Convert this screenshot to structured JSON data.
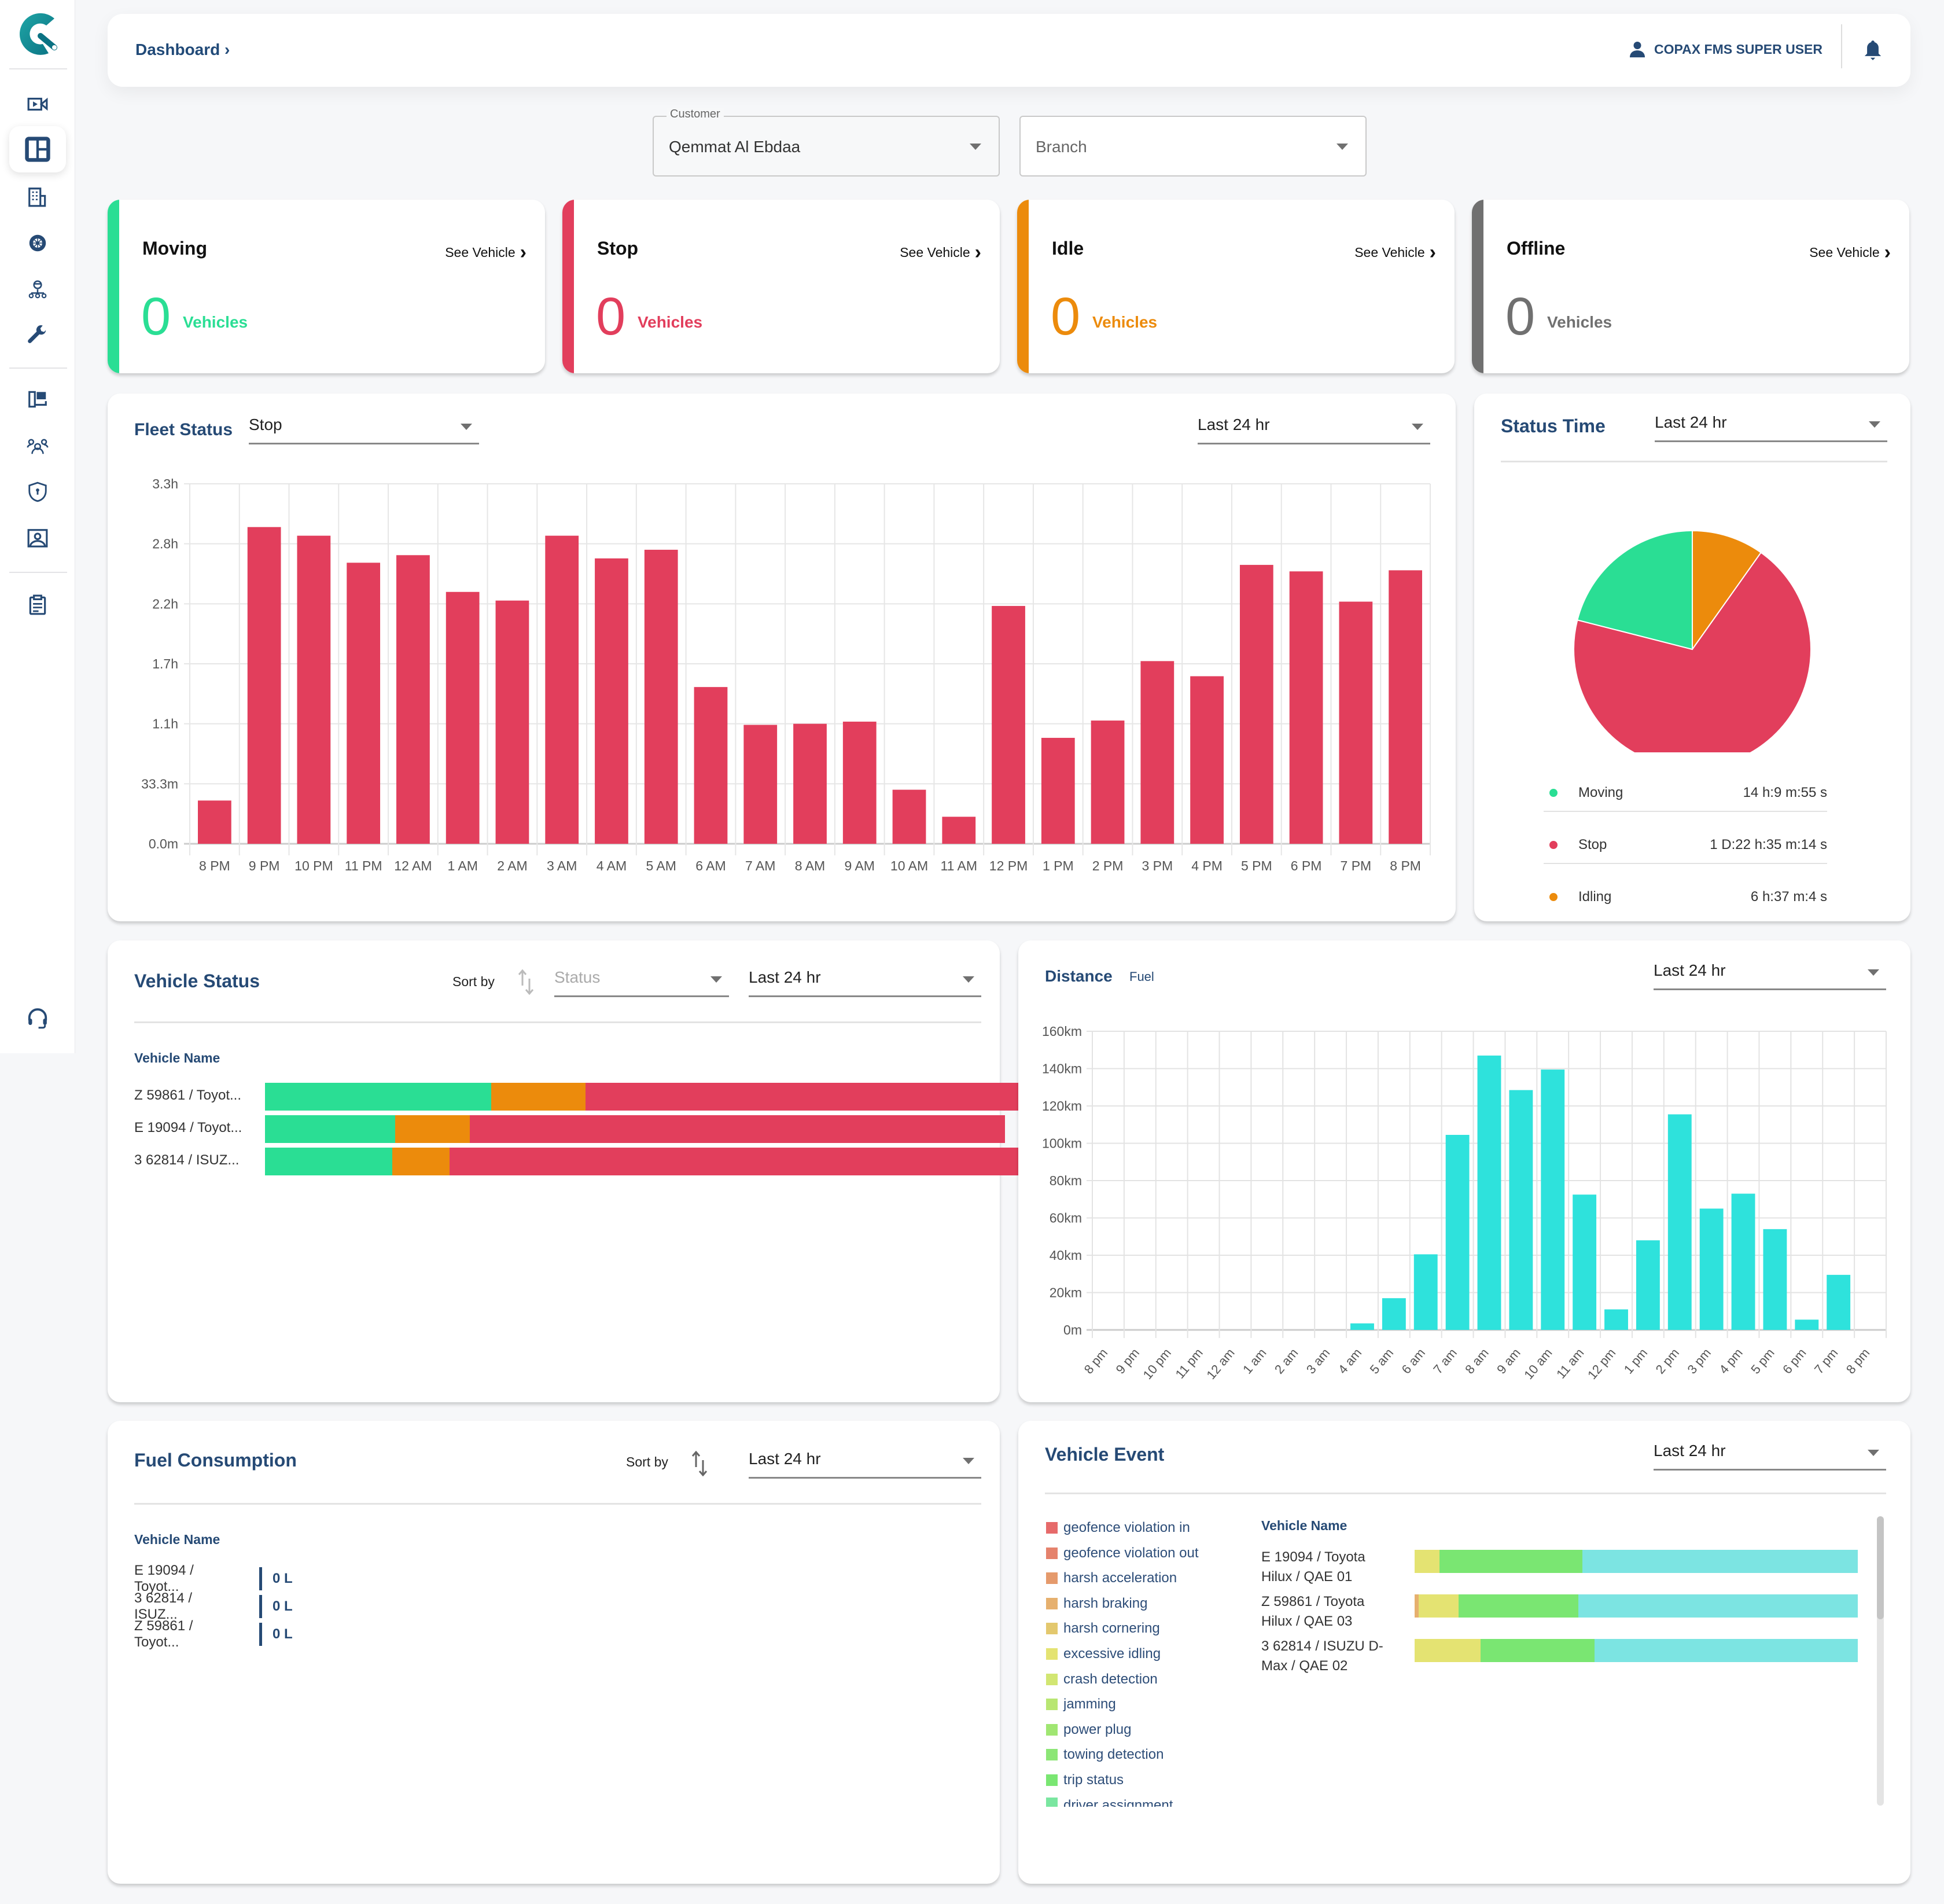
{
  "header": {
    "breadcrumb": "Dashboard",
    "breadcrumb_sep": "›",
    "user_name": "COPAX FMS SUPER USER"
  },
  "sidebar": {
    "items": [
      {
        "icon": "video-camera-icon"
      },
      {
        "icon": "dashboard-icon",
        "active": true
      },
      {
        "icon": "building-icon"
      },
      {
        "icon": "tire-icon"
      },
      {
        "icon": "driver-network-icon"
      },
      {
        "icon": "wrench-icon"
      },
      {
        "icon": "map-report-icon"
      },
      {
        "icon": "users-group-icon"
      },
      {
        "icon": "shield-lock-icon"
      },
      {
        "icon": "contact-card-icon"
      },
      {
        "icon": "clipboard-icon"
      }
    ],
    "support_icon": "headset-icon"
  },
  "filters": {
    "customer": {
      "label": "Customer",
      "value": "Qemmat Al Ebdaa"
    },
    "branch": {
      "placeholder": "Branch"
    }
  },
  "status_cards": [
    {
      "title": "Moving",
      "link": "See Vehicle",
      "count": "0",
      "unit": "Vehicles",
      "color": "#2ade94"
    },
    {
      "title": "Stop",
      "link": "See Vehicle",
      "count": "0",
      "unit": "Vehicles",
      "color": "#e23e5c"
    },
    {
      "title": "Idle",
      "link": "See Vehicle",
      "count": "0",
      "unit": "Vehicles",
      "color": "#ec8b0c"
    },
    {
      "title": "Offline",
      "link": "See Vehicle",
      "count": "0",
      "unit": "Vehicles",
      "color": "#707070"
    }
  ],
  "fleet_status": {
    "title": "Fleet Status",
    "status_select": "Stop",
    "range_select": "Last 24 hr"
  },
  "status_time": {
    "title": "Status Time",
    "range_select": "Last 24 hr",
    "legend": [
      {
        "label": "Moving",
        "value": "14 h:9 m:55 s",
        "color": "#2ade94"
      },
      {
        "label": "Stop",
        "value": "1 D:22 h:35 m:14 s",
        "color": "#e23e5c"
      },
      {
        "label": "Idling",
        "value": "6 h:37 m:4 s",
        "color": "#ec8b0c"
      }
    ]
  },
  "vehicle_status": {
    "title": "Vehicle Status",
    "sort_label": "Sort by",
    "sort_placeholder": "Status",
    "range_select": "Last 24 hr",
    "column_header": "Vehicle Name",
    "rows": [
      {
        "name": "Z 59861 / Toyot...",
        "moving": 0.295,
        "idle": 0.123,
        "stop": 0.58
      },
      {
        "name": "E 19094 / Toyot...",
        "moving": 0.17,
        "idle": 0.097,
        "stop": 0.698
      },
      {
        "name": "3 62814 / ISUZ...",
        "moving": 0.166,
        "idle": 0.075,
        "stop": 0.801
      }
    ]
  },
  "distance": {
    "title": "Distance",
    "alt_tab": "Fuel",
    "range_select": "Last 24 hr"
  },
  "fuel_consumption": {
    "title": "Fuel Consumption",
    "sort_label": "Sort by",
    "range_select": "Last 24 hr",
    "column_header": "Vehicle Name",
    "rows": [
      {
        "name": "E 19094 / Toyot...",
        "value": "0 L"
      },
      {
        "name": "3 62814 / ISUZ...",
        "value": "0 L"
      },
      {
        "name": "Z 59861 / Toyot...",
        "value": "0 L"
      }
    ]
  },
  "vehicle_event": {
    "title": "Vehicle Event",
    "range_select": "Last 24 hr",
    "column_header": "Vehicle Name",
    "legend": [
      {
        "label": "geofence violation in",
        "color": "#e66a6a"
      },
      {
        "label": "geofence violation out",
        "color": "#e5826c"
      },
      {
        "label": "harsh acceleration",
        "color": "#e59a6c"
      },
      {
        "label": "harsh braking",
        "color": "#e6b06e"
      },
      {
        "label": "harsh cornering",
        "color": "#e3c86e"
      },
      {
        "label": "excessive idling",
        "color": "#e4e372"
      },
      {
        "label": "crash detection",
        "color": "#d2e672"
      },
      {
        "label": "jamming",
        "color": "#b8e672"
      },
      {
        "label": "power plug",
        "color": "#a0e672"
      },
      {
        "label": "towing detection",
        "color": "#8ce676"
      },
      {
        "label": "trip status",
        "color": "#7ae672"
      },
      {
        "label": "driver assignment",
        "color": "#7ae6a0"
      }
    ],
    "rows": [
      {
        "name": "E 19094 / Toyota Hilux / QAE 01",
        "segments": [
          {
            "event": "excessive idling",
            "share": 0.056,
            "color": "#e4e372"
          },
          {
            "event": "trip status",
            "share": 0.322,
            "color": "#7ae672"
          },
          {
            "event": "other",
            "share": 0.622,
            "color": "#7ce4e2"
          }
        ]
      },
      {
        "name": "Z 59861 / Toyota Hilux / QAE 03",
        "segments": [
          {
            "event": "harsh braking",
            "share": 0.009,
            "color": "#e6b06e"
          },
          {
            "event": "excessive idling",
            "share": 0.09,
            "color": "#e4e372"
          },
          {
            "event": "trip status",
            "share": 0.27,
            "color": "#7ae672"
          },
          {
            "event": "other",
            "share": 0.631,
            "color": "#7ce4e2"
          }
        ]
      },
      {
        "name": "3 62814 / ISUZU D-Max / QAE 02",
        "segments": [
          {
            "event": "excessive idling",
            "share": 0.149,
            "color": "#e4e372"
          },
          {
            "event": "trip status",
            "share": 0.257,
            "color": "#7ae672"
          },
          {
            "event": "other",
            "share": 0.594,
            "color": "#7ce4e2"
          }
        ]
      }
    ]
  },
  "chart_data": [
    {
      "type": "bar",
      "title": "Fleet Status",
      "series_name": "Stop",
      "color": "#e23e5c",
      "categories": [
        "8 PM",
        "9 PM",
        "10 PM",
        "11 PM",
        "12 AM",
        "1 AM",
        "2 AM",
        "3 AM",
        "4 AM",
        "5 AM",
        "6 AM",
        "7 AM",
        "8 AM",
        "9 AM",
        "10 AM",
        "11 AM",
        "12 PM",
        "1 PM",
        "2 PM",
        "3 PM",
        "4 PM",
        "5 PM",
        "6 PM",
        "7 PM",
        "8 PM"
      ],
      "values_hours": [
        0.4,
        2.93,
        2.85,
        2.6,
        2.67,
        2.33,
        2.25,
        2.85,
        2.64,
        2.72,
        1.45,
        1.1,
        1.11,
        1.13,
        0.5,
        0.25,
        2.2,
        0.98,
        1.14,
        1.69,
        1.55,
        2.58,
        2.52,
        2.24,
        2.53
      ],
      "y_ticks": [
        "0.0m",
        "33.3m",
        "1.1h",
        "1.7h",
        "2.2h",
        "2.8h",
        "3.3h"
      ],
      "ylim_hours": [
        0,
        3.33
      ],
      "grid": true
    },
    {
      "type": "pie",
      "title": "Status Time",
      "slices": [
        {
          "label": "Idling",
          "value_seconds": 23824,
          "color": "#ec8b0c"
        },
        {
          "label": "Stop",
          "value_seconds": 167714,
          "color": "#e23e5c"
        },
        {
          "label": "Moving",
          "value_seconds": 50995,
          "color": "#2ade94"
        }
      ]
    },
    {
      "type": "bar",
      "title": "Distance",
      "color": "#2ee2dc",
      "categories": [
        "8 pm",
        "9 pm",
        "10 pm",
        "11 pm",
        "12 am",
        "1 am",
        "2 am",
        "3 am",
        "4 am",
        "5 am",
        "6 am",
        "7 am",
        "8 am",
        "9 am",
        "10 am",
        "11 am",
        "12 pm",
        "1 pm",
        "2 pm",
        "3 pm",
        "4 pm",
        "5 pm",
        "6 pm",
        "7 pm",
        "8 pm"
      ],
      "values_km": [
        0,
        0,
        0,
        0,
        0,
        0,
        0,
        0,
        3.5,
        17,
        40.5,
        104.5,
        147,
        128.5,
        139.5,
        72.5,
        11,
        48,
        115.5,
        65,
        73,
        54,
        5.5,
        29.5,
        0
      ],
      "y_ticks": [
        "0m",
        "20km",
        "40km",
        "60km",
        "80km",
        "100km",
        "120km",
        "140km",
        "160km"
      ],
      "ylim_km": [
        0,
        160
      ],
      "grid": true
    }
  ]
}
